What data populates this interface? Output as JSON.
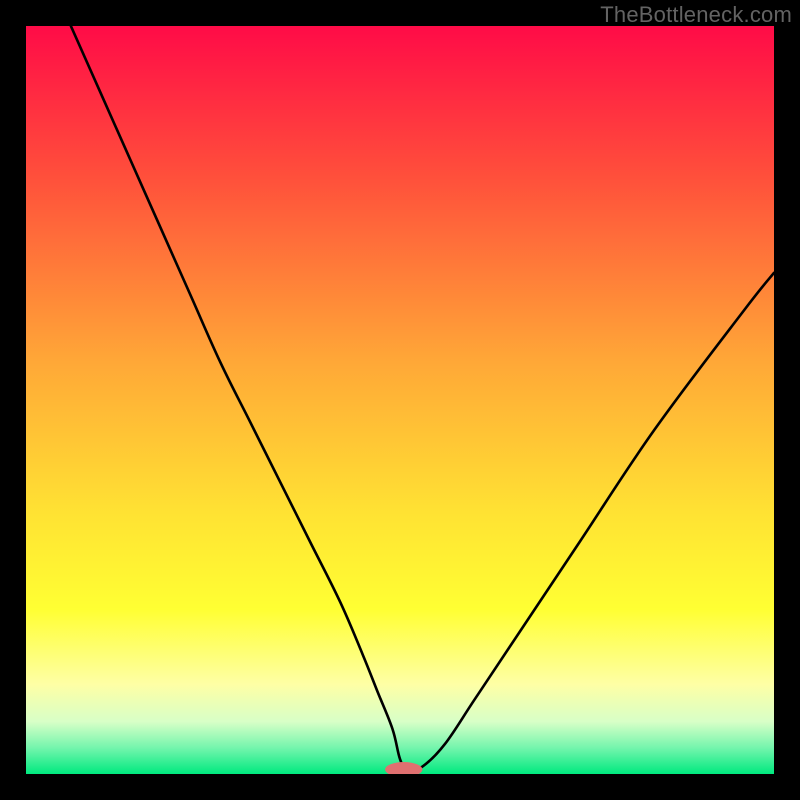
{
  "watermark": "TheBottleneck.com",
  "colors": {
    "frame": "#000000",
    "curve_stroke": "#000000",
    "marker_fill": "#e07070",
    "gradient_stops": [
      {
        "offset": 0.0,
        "color": "#ff0b47"
      },
      {
        "offset": 0.2,
        "color": "#ff4f3b"
      },
      {
        "offset": 0.45,
        "color": "#ffa837"
      },
      {
        "offset": 0.65,
        "color": "#ffe233"
      },
      {
        "offset": 0.78,
        "color": "#ffff33"
      },
      {
        "offset": 0.88,
        "color": "#feffa5"
      },
      {
        "offset": 0.93,
        "color": "#d8ffc7"
      },
      {
        "offset": 0.965,
        "color": "#74f5ad"
      },
      {
        "offset": 1.0,
        "color": "#00e97f"
      }
    ]
  },
  "chart_data": {
    "type": "line",
    "title": "",
    "xlabel": "",
    "ylabel": "",
    "xlim": [
      0,
      100
    ],
    "ylim": [
      0,
      100
    ],
    "x": [
      6,
      10,
      14,
      18,
      22,
      26,
      30,
      34,
      38,
      42,
      45,
      47,
      49,
      50,
      51,
      53,
      56,
      60,
      66,
      74,
      84,
      96,
      100
    ],
    "values": [
      100,
      91,
      82,
      73,
      64,
      55,
      47,
      39,
      31,
      23,
      16,
      11,
      6,
      2,
      0.5,
      1,
      4,
      10,
      19,
      31,
      46,
      62,
      67
    ],
    "minimum_x": 50.5,
    "marker": {
      "x": 50.5,
      "y": 0.6,
      "rx": 2.5,
      "ry": 1.0
    }
  }
}
